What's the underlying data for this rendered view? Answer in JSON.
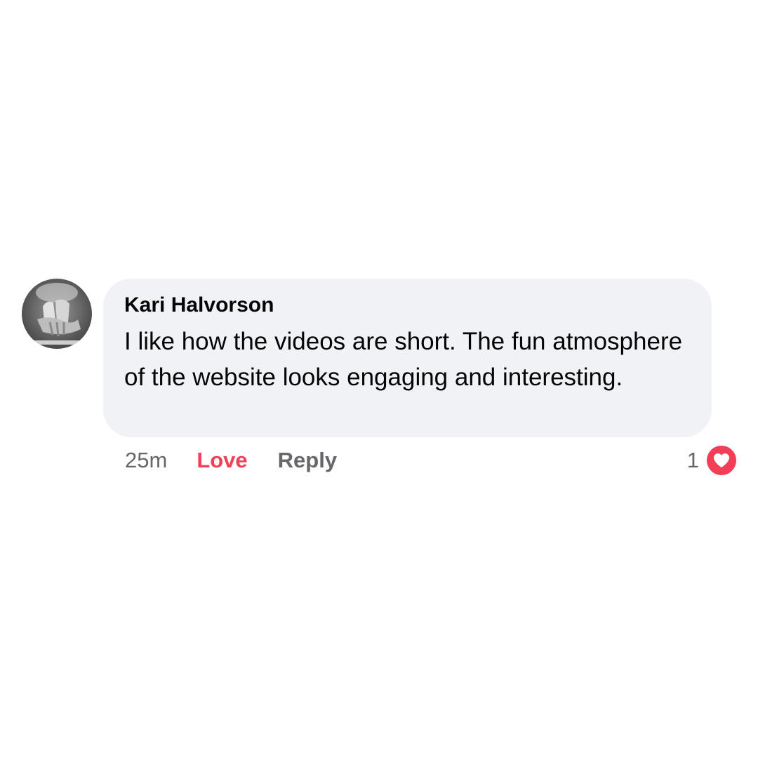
{
  "comment": {
    "author": "Kari Halvorson",
    "text": "I like how the videos are short. The fun atmosphere of the website looks engaging and interesting.",
    "avatar_icon": "profile-photo-hands",
    "bubble_color": "#f0f2f5"
  },
  "actions": {
    "timestamp": "25m",
    "love_label": "Love",
    "reply_label": "Reply",
    "love_color": "#f33e58"
  },
  "reactions": {
    "count": "1",
    "icon": "heart-icon",
    "color": "#f33e58"
  }
}
